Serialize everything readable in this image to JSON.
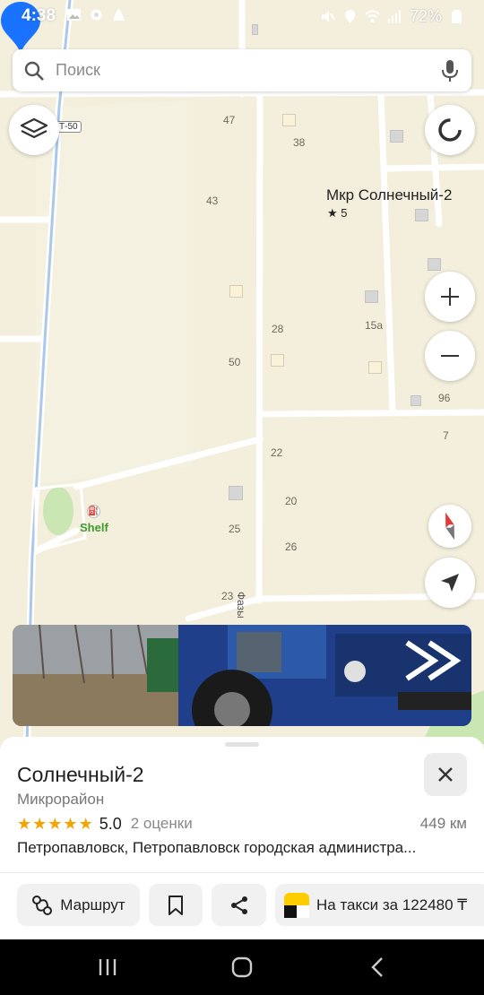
{
  "status_bar": {
    "time": "4:38",
    "battery": "72%"
  },
  "search": {
    "placeholder": "Поиск"
  },
  "map": {
    "pin_name": "Мкр Солнечный-2",
    "pin_rating": "★ 5",
    "poi_name": "Shelf",
    "road_name": "Фазы",
    "road_badge": "Т-50",
    "house_numbers": [
      "47",
      "38",
      "43",
      "28",
      "15а",
      "50",
      "96",
      "7",
      "22",
      "20",
      "25",
      "26",
      "23"
    ],
    "accent_color": "#1a73ff"
  },
  "place": {
    "title": "Солнечный-2",
    "category": "Микрорайон",
    "rating": "5.0",
    "rating_count": "2 оценки",
    "distance": "449 км",
    "address": "Петропавловск, Петропавловск городская администра..."
  },
  "actions": {
    "route_label": "Маршрут",
    "taxi_label": "На такси за 122480 ₸"
  }
}
